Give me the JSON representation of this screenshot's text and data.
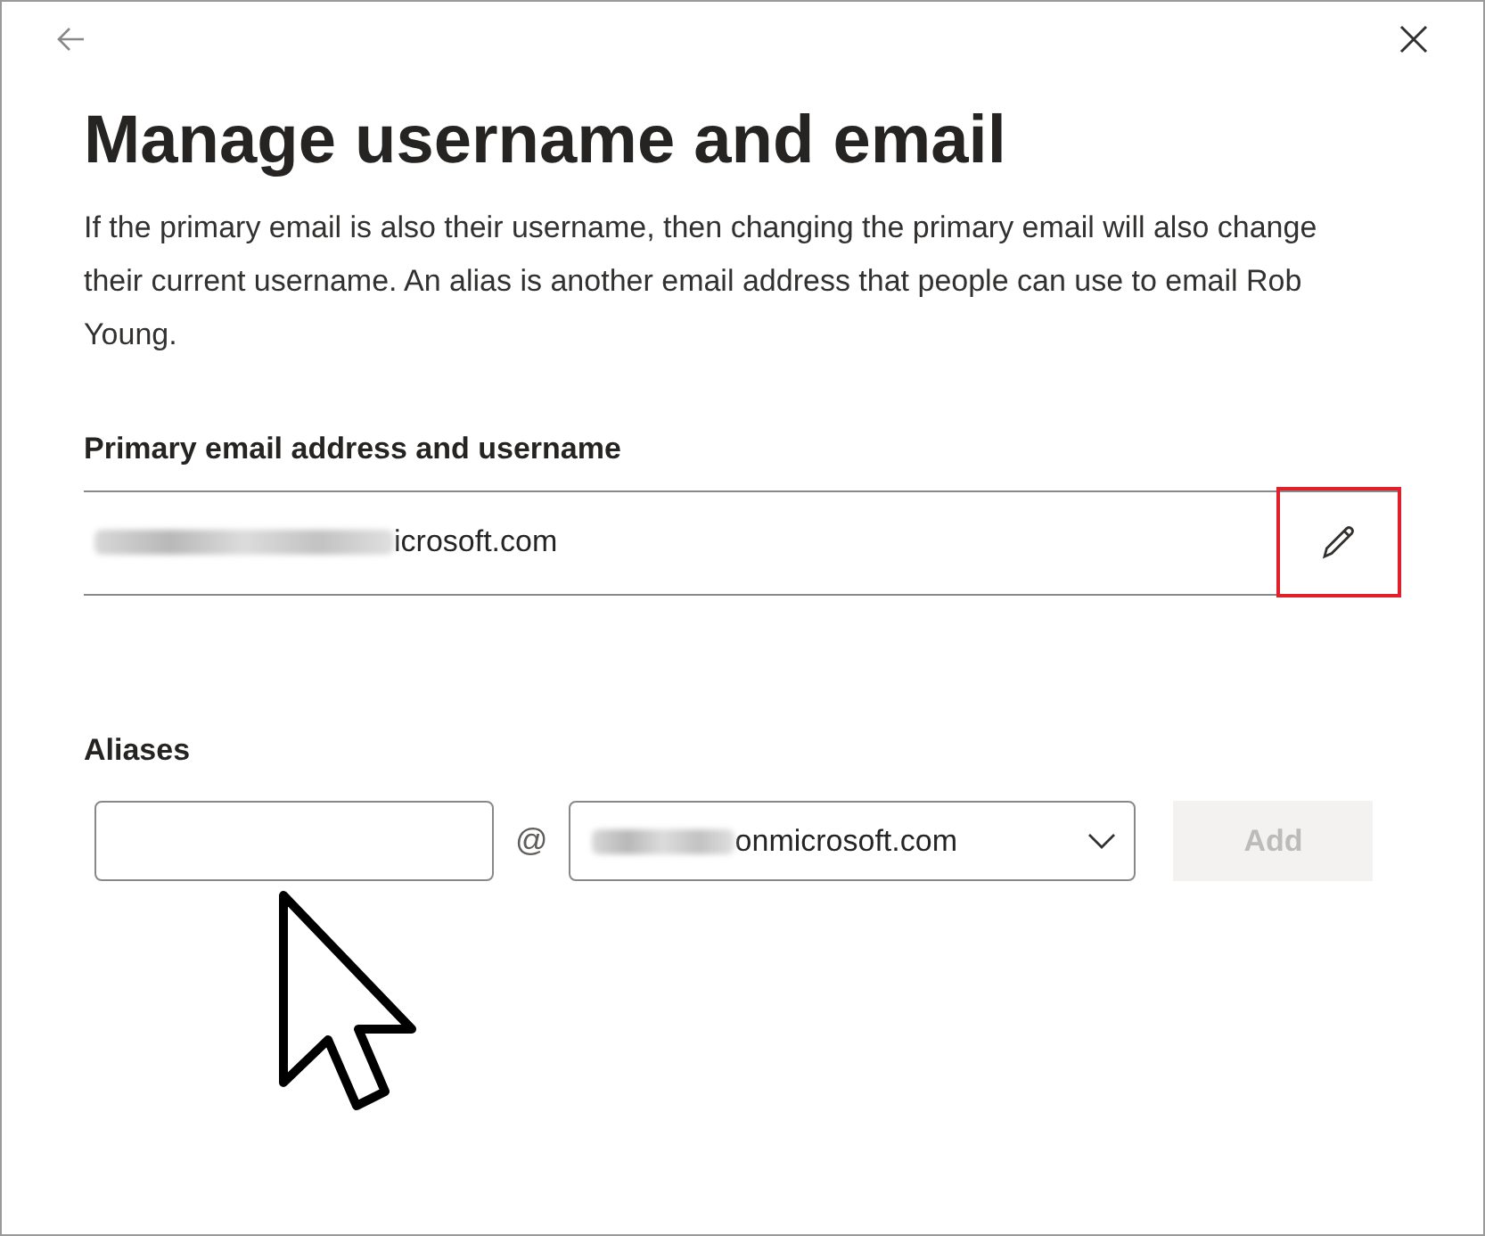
{
  "dialog": {
    "title": "Manage username and email",
    "description": "If the primary email is also their username, then changing the primary email will also change their current username. An alias is another email address that people can use to email Rob Young."
  },
  "primary": {
    "label": "Primary email address and username",
    "value": "icrosoft.com",
    "edit_highlighted": true
  },
  "aliases": {
    "label": "Aliases",
    "separator": "@",
    "domain": "onmicrosoft.com",
    "add_button": {
      "label": "Add",
      "disabled": true
    }
  }
}
